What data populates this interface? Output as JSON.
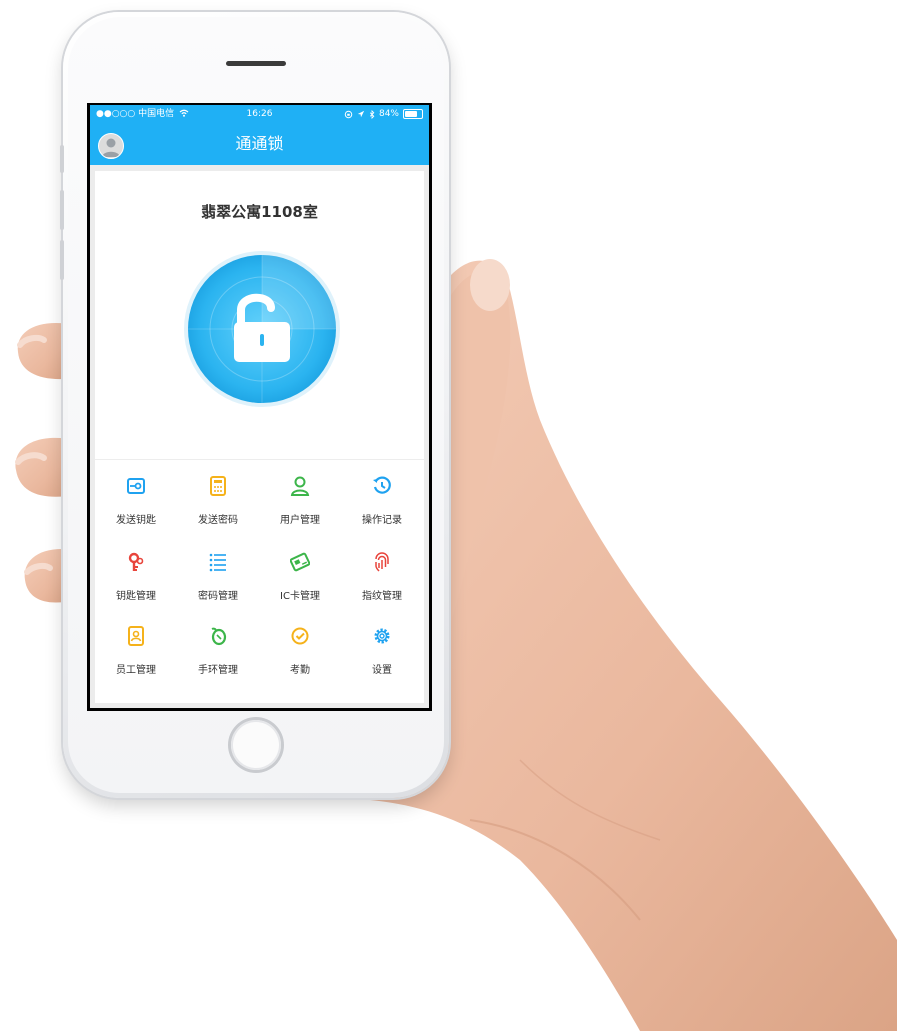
{
  "status_bar": {
    "carrier": "●●○○○ 中国电信",
    "time": "16:26",
    "battery": "84%",
    "battery_level": 0.84
  },
  "header": {
    "title": "通通锁"
  },
  "main": {
    "room": "翡翠公寓1108室"
  },
  "menu": [
    {
      "label": "发送钥匙",
      "icon": "send-key-icon",
      "color": "#1fa2f0"
    },
    {
      "label": "发送密码",
      "icon": "send-password-icon",
      "color": "#f5b21b"
    },
    {
      "label": "用户管理",
      "icon": "user-icon",
      "color": "#3cb54a"
    },
    {
      "label": "操作记录",
      "icon": "history-icon",
      "color": "#1fa2f0"
    },
    {
      "label": "钥匙管理",
      "icon": "key-icon",
      "color": "#e8453c"
    },
    {
      "label": "密码管理",
      "icon": "list-icon",
      "color": "#1fa2f0"
    },
    {
      "label": "IC卡管理",
      "icon": "ic-card-icon",
      "color": "#3cb54a"
    },
    {
      "label": "指纹管理",
      "icon": "fingerprint-icon",
      "color": "#e8453c"
    },
    {
      "label": "员工管理",
      "icon": "badge-icon",
      "color": "#f5b21b"
    },
    {
      "label": "手环管理",
      "icon": "bracelet-icon",
      "color": "#3cb54a"
    },
    {
      "label": "考勤",
      "icon": "attendance-icon",
      "color": "#f5b21b"
    },
    {
      "label": "设置",
      "icon": "gear-icon",
      "color": "#1fa2f0"
    }
  ],
  "colors": {
    "accent": "#1fb0f5"
  }
}
